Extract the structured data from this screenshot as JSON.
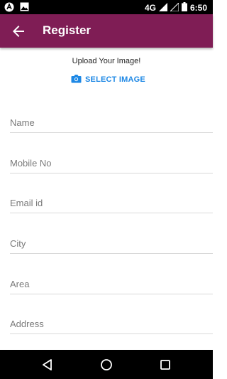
{
  "status_bar": {
    "network": "4G",
    "time": "6:50"
  },
  "app_bar": {
    "title": "Register",
    "back_icon": "arrow-back-icon"
  },
  "upload": {
    "caption": "Upload Your Image!",
    "button_label": "SELECT IMAGE",
    "button_icon": "camera-icon"
  },
  "form": {
    "fields": [
      {
        "placeholder": "Name"
      },
      {
        "placeholder": "Mobile No"
      },
      {
        "placeholder": "Email id"
      },
      {
        "placeholder": "City"
      },
      {
        "placeholder": "Area"
      },
      {
        "placeholder": "Address"
      }
    ]
  },
  "colors": {
    "app_bar": "#7f1d55",
    "accent": "#1e88e5"
  }
}
